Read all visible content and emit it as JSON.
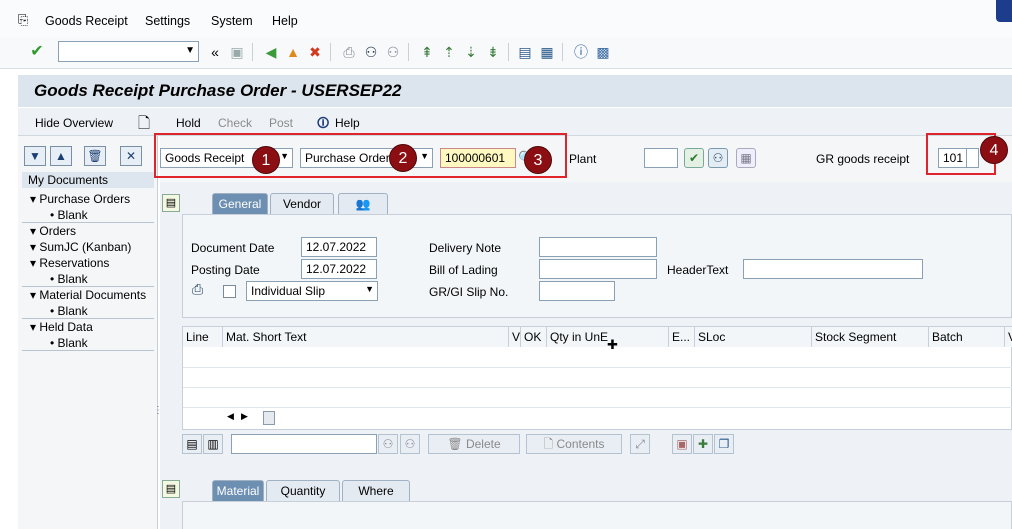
{
  "menu": {
    "items": [
      "Goods Receipt",
      "Settings",
      "System",
      "Help"
    ]
  },
  "toolbar": {
    "command_field": ""
  },
  "title": "Goods Receipt Purchase Order - USERSEP22",
  "app_toolbar": {
    "hide_overview": "Hide Overview",
    "hold": "Hold",
    "check": "Check",
    "post": "Post",
    "help": "Help"
  },
  "left_pane": {
    "heading": "My Documents",
    "tree": [
      {
        "label": "Purchase Orders",
        "level": 0,
        "expanded": true
      },
      {
        "label": "Blank",
        "level": 1
      },
      {
        "label": "Orders",
        "level": 0
      },
      {
        "label": "SumJC (Kanban)",
        "level": 0
      },
      {
        "label": "Reservations",
        "level": 0,
        "expanded": true
      },
      {
        "label": "Blank",
        "level": 1
      },
      {
        "label": "Material Documents",
        "level": 0,
        "expanded": true
      },
      {
        "label": "Blank",
        "level": 1
      },
      {
        "label": "Held Data",
        "level": 0,
        "expanded": true
      },
      {
        "label": "Blank",
        "level": 1
      }
    ]
  },
  "header": {
    "transaction": "Goods Receipt",
    "reference": "Purchase Order",
    "po_number": "100000601",
    "plant_label": "Plant",
    "plant_value": "",
    "movement_label": "GR goods receipt",
    "movement_type": "101",
    "annotations": [
      "1",
      "2",
      "3",
      "4"
    ]
  },
  "header_tabs": [
    "General",
    "Vendor"
  ],
  "general": {
    "document_date_label": "Document Date",
    "document_date": "12.07.2022",
    "posting_date_label": "Posting Date",
    "posting_date": "12.07.2022",
    "slip_type": "Individual Slip",
    "delivery_note_label": "Delivery Note",
    "bill_of_lading_label": "Bill of Lading",
    "gr_slip_label": "GR/GI Slip No.",
    "header_text_label": "HeaderText"
  },
  "grid": {
    "columns": [
      "Line",
      "Mat. Short Text",
      "V",
      "OK",
      "Qty in UnE",
      "E...",
      "SLoc",
      "Stock Segment",
      "Batch",
      "V"
    ]
  },
  "grid_toolbar": {
    "delete": "Delete",
    "contents": "Contents"
  },
  "item_tabs": [
    "Material",
    "Quantity",
    "Where"
  ],
  "colors": {
    "annotation_box": "#e0242b",
    "annotation_badge": "#8b0f12",
    "active_tab": "#6d8fb1",
    "title_bar": "#dce4ed"
  }
}
